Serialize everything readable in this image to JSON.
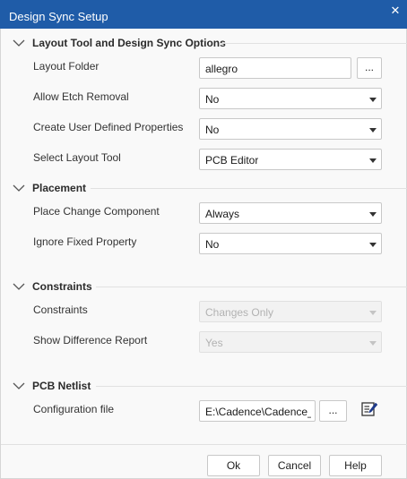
{
  "window": {
    "title": "Design Sync Setup",
    "close_icon": "close-icon"
  },
  "sections": {
    "layout": {
      "title": "Layout Tool and Design Sync Options",
      "rows": {
        "layout_folder": {
          "label": "Layout Folder",
          "value": "allegro",
          "browse": "..."
        },
        "allow_etch": {
          "label": "Allow Etch Removal",
          "value": "No"
        },
        "user_props": {
          "label": "Create User Defined Properties",
          "value": "No"
        },
        "layout_tool": {
          "label": "Select Layout Tool",
          "value": "PCB Editor"
        }
      }
    },
    "placement": {
      "title": "Placement",
      "rows": {
        "place_change": {
          "label": "Place Change Component",
          "value": "Always"
        },
        "ignore_fixed": {
          "label": "Ignore Fixed Property",
          "value": "No"
        }
      }
    },
    "constraints": {
      "title": "Constraints",
      "rows": {
        "constraints": {
          "label": "Constraints",
          "value": "Changes Only",
          "disabled": true
        },
        "diff_report": {
          "label": "Show Difference Report",
          "value": "Yes",
          "disabled": true
        }
      }
    },
    "netlist": {
      "title": "PCB Netlist",
      "rows": {
        "config_file": {
          "label": "Configuration file",
          "value": "E:\\Cadence\\Cadence_S",
          "browse": "...",
          "edit_icon": "edit-file-icon"
        }
      }
    }
  },
  "buttons": {
    "ok": "Ok",
    "cancel": "Cancel",
    "help": "Help"
  },
  "colors": {
    "titlebar": "#1f5ca8",
    "background": "#f9f9f9",
    "disabled_text": "#b2b2b2"
  }
}
